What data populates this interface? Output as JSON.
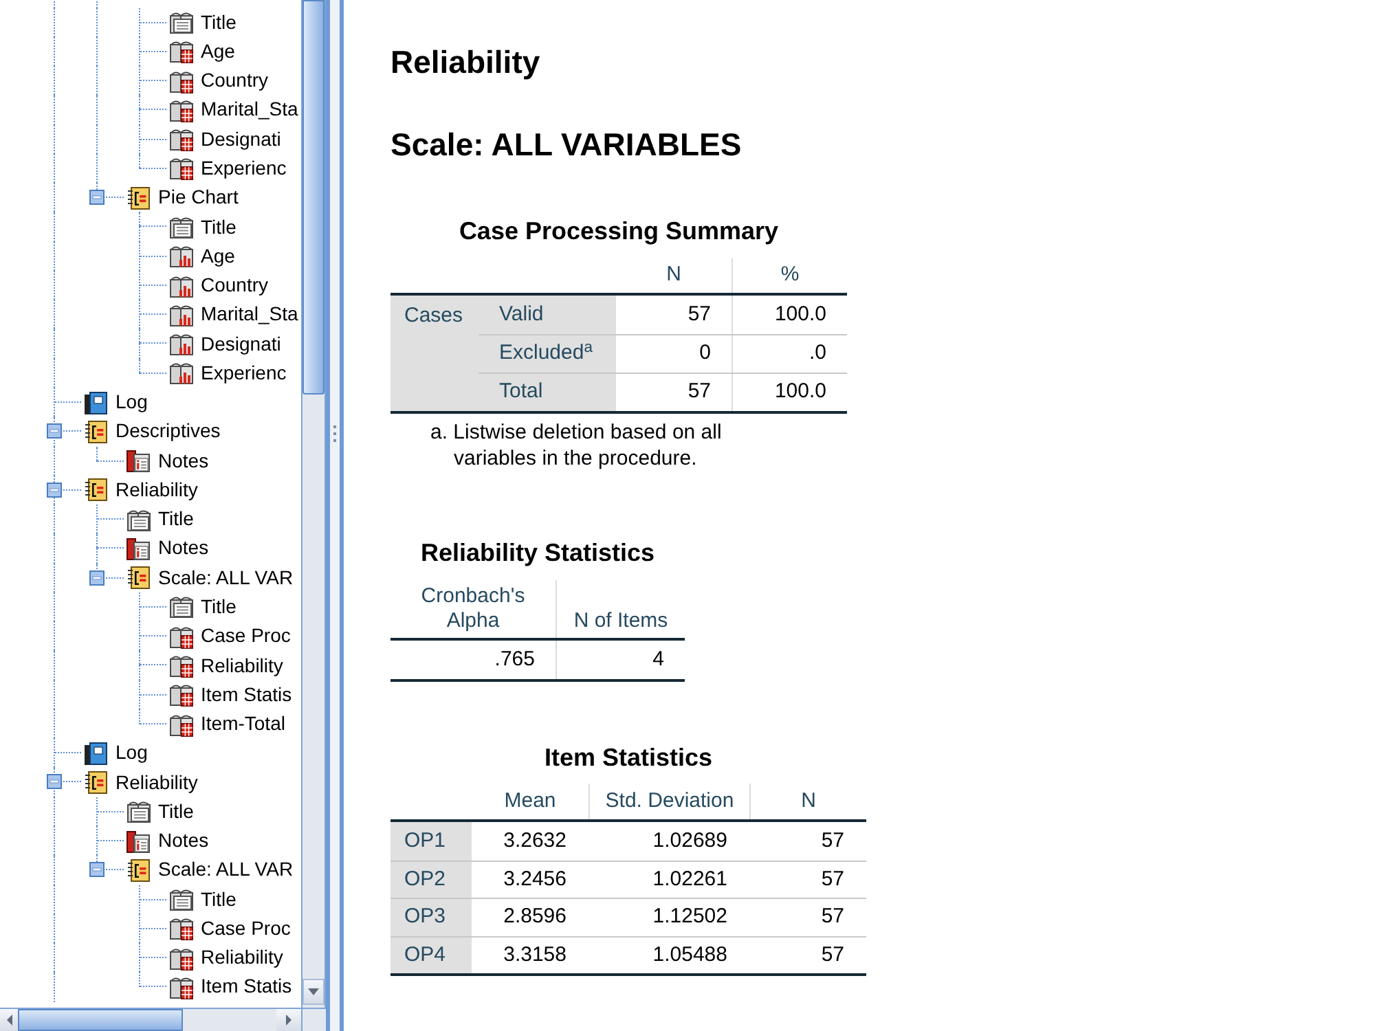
{
  "navigator": {
    "tree": [
      {
        "children": [
          {
            "children": [
              {
                "label": "Title",
                "kind": "title"
              },
              {
                "label": "Age",
                "kind": "table"
              },
              {
                "label": "Country",
                "kind": "table"
              },
              {
                "label": "Marital_Sta",
                "kind": "table"
              },
              {
                "label": "Designati",
                "kind": "table"
              },
              {
                "label": "Experienc",
                "kind": "table"
              }
            ]
          },
          {
            "label": "Pie Chart",
            "kind": "folder",
            "expanded": true,
            "children": [
              {
                "label": "Title",
                "kind": "title"
              },
              {
                "label": "Age",
                "kind": "chart"
              },
              {
                "label": "Country",
                "kind": "chart"
              },
              {
                "label": "Marital_Sta",
                "kind": "chart"
              },
              {
                "label": "Designati",
                "kind": "chart"
              },
              {
                "label": "Experienc",
                "kind": "chart"
              }
            ]
          }
        ]
      },
      {
        "label": "Log",
        "kind": "log"
      },
      {
        "label": "Descriptives",
        "kind": "folder",
        "expanded": true,
        "children": [
          {
            "label": "Notes",
            "kind": "notes"
          }
        ]
      },
      {
        "label": "Reliability",
        "kind": "folder",
        "expanded": true,
        "children": [
          {
            "label": "Title",
            "kind": "title"
          },
          {
            "label": "Notes",
            "kind": "notes"
          },
          {
            "label": "Scale: ALL VAR",
            "kind": "folder",
            "expanded": true,
            "children": [
              {
                "label": "Title",
                "kind": "title"
              },
              {
                "label": "Case Proc",
                "kind": "table"
              },
              {
                "label": "Reliability",
                "kind": "table"
              },
              {
                "label": "Item Statis",
                "kind": "table"
              },
              {
                "label": "Item-Total",
                "kind": "table"
              }
            ]
          }
        ]
      },
      {
        "label": "Log",
        "kind": "log"
      },
      {
        "label": "Reliability",
        "kind": "folder",
        "expanded": true,
        "children": [
          {
            "label": "Title",
            "kind": "title"
          },
          {
            "label": "Notes",
            "kind": "notes"
          },
          {
            "label": "Scale: ALL VAR",
            "kind": "folder",
            "expanded": true,
            "children": [
              {
                "label": "Title",
                "kind": "title"
              },
              {
                "label": "Case Proc",
                "kind": "table"
              },
              {
                "label": "Reliability",
                "kind": "table"
              },
              {
                "label": "Item Statis",
                "kind": "table"
              }
            ]
          }
        ]
      }
    ]
  },
  "output": {
    "heading": "Reliability",
    "subheading": "Scale: ALL VARIABLES",
    "case_processing_summary": {
      "title": "Case Processing Summary",
      "columns": [
        "N",
        "%"
      ],
      "row_group": "Cases",
      "rows": [
        {
          "label": "Valid",
          "values": [
            "57",
            "100.0"
          ]
        },
        {
          "label": "Excluded$^{a}$",
          "values": [
            "0",
            ".0"
          ]
        },
        {
          "label": "Total",
          "values": [
            "57",
            "100.0"
          ]
        }
      ],
      "footnote": "a. Listwise deletion based on all variables in the procedure."
    },
    "reliability_statistics": {
      "title": "Reliability Statistics",
      "columns": [
        "Cronbach's Alpha",
        "N of Items"
      ],
      "rows": [
        {
          "values": [
            ".765",
            "4"
          ]
        }
      ]
    },
    "item_statistics": {
      "title": "Item Statistics",
      "columns": [
        "Mean",
        "Std. Deviation",
        "N"
      ],
      "rows": [
        {
          "label": "OP1",
          "values": [
            "3.2632",
            "1.02689",
            "57"
          ]
        },
        {
          "label": "OP2",
          "values": [
            "3.2456",
            "1.02261",
            "57"
          ]
        },
        {
          "label": "OP3",
          "values": [
            "2.8596",
            "1.12502",
            "57"
          ]
        },
        {
          "label": "OP4",
          "values": [
            "3.3158",
            "1.05488",
            "57"
          ]
        }
      ]
    }
  }
}
